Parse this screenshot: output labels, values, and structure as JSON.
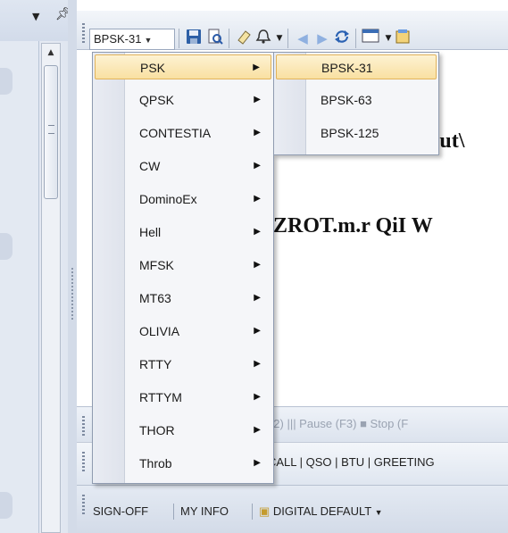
{
  "left_panel": {
    "dropdown_glyph": "▼",
    "pin_glyph": "ꟸ"
  },
  "toolbar": {
    "mode_value": "BPSK-31",
    "icons": [
      "save-icon",
      "print-preview-icon",
      "eraser-icon",
      "bell-icon",
      "back-icon",
      "forward-icon",
      "refresh-icon",
      "view-icon",
      "properties-icon"
    ]
  },
  "document": {
    "line1": "but\\",
    "line2": "ZROT.m.r QiI W"
  },
  "mode_menu": {
    "items": [
      {
        "label": "PSK",
        "highlighted": true
      },
      {
        "label": "QPSK"
      },
      {
        "label": "CONTESTIA"
      },
      {
        "label": "CW"
      },
      {
        "label": "DominoEx"
      },
      {
        "label": "Hell"
      },
      {
        "label": "MFSK"
      },
      {
        "label": "MT63"
      },
      {
        "label": "OLIVIA"
      },
      {
        "label": "RTTY"
      },
      {
        "label": "RTTYM"
      },
      {
        "label": "THOR"
      },
      {
        "label": "Throb"
      }
    ]
  },
  "psk_submenu": {
    "items": [
      {
        "label": "BPSK-31",
        "highlighted": true
      },
      {
        "label": "BPSK-63"
      },
      {
        "label": "BPSK-125"
      }
    ]
  },
  "control_bar": {
    "text": "(F2)  ||| Pause  (F3)   ■ Stop  (F"
  },
  "macro_bar": {
    "text": "CALL | QSO | BTU | GREETING"
  },
  "bottom_bar": {
    "sign_off": "SIGN-OFF",
    "my_info": "MY INFO",
    "digital_default": "DIGITAL DEFAULT"
  },
  "colors": {
    "menu_highlight": "#f9e0a1",
    "menu_highlight_border": "#e2b35a",
    "panel_blue": "#d6dde9"
  }
}
